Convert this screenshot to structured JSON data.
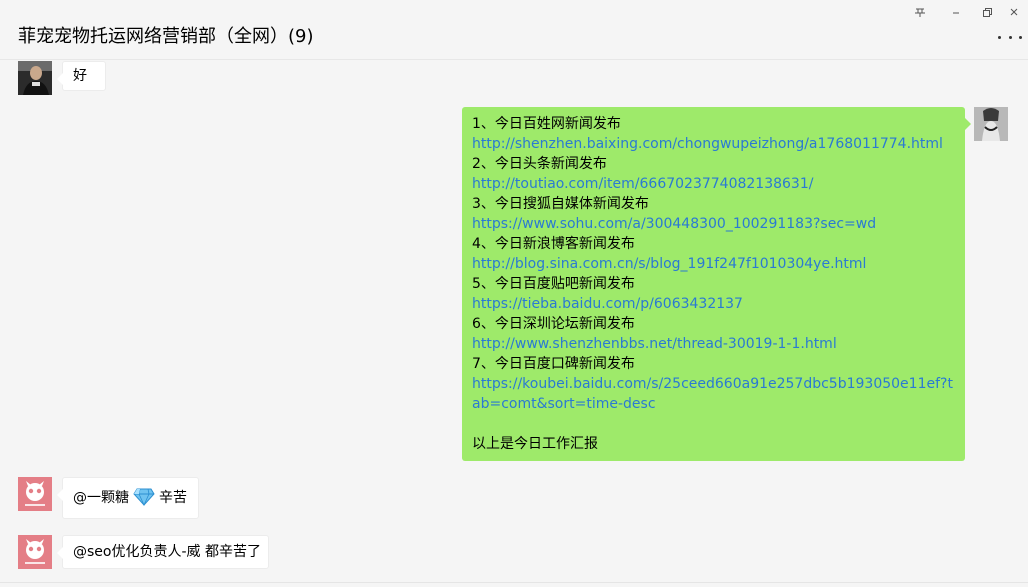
{
  "window": {
    "title": "菲宠宠物托运网络营销部（全网）(9)",
    "pin_icon": "pin-icon",
    "minimize_icon": "minimize-icon",
    "restore_icon": "restore-icon",
    "more_icon": "more-dots-icon"
  },
  "messages": [
    {
      "sender": "other",
      "avatar": "man-photo-avatar",
      "text": "好"
    },
    {
      "sender": "me",
      "avatar": "woman-photo-avatar",
      "lines": [
        {
          "kind": "text",
          "value": "1、今日百姓网新闻发布"
        },
        {
          "kind": "link",
          "value": "http://shenzhen.baixing.com/chongwupeizhong/a1768011774.html"
        },
        {
          "kind": "text",
          "value": "2、今日头条新闻发布"
        },
        {
          "kind": "link",
          "value": "http://toutiao.com/item/6667023774082138631/"
        },
        {
          "kind": "text",
          "value": "3、今日搜狐自媒体新闻发布"
        },
        {
          "kind": "link",
          "value": "https://www.sohu.com/a/300448300_100291183?sec=wd"
        },
        {
          "kind": "text",
          "value": "4、今日新浪博客新闻发布"
        },
        {
          "kind": "link",
          "value": "http://blog.sina.com.cn/s/blog_191f247f1010304ye.html"
        },
        {
          "kind": "text",
          "value": "5、今日百度贴吧新闻发布"
        },
        {
          "kind": "link",
          "value": "https://tieba.baidu.com/p/6063432137"
        },
        {
          "kind": "text",
          "value": "6、今日深圳论坛新闻发布"
        },
        {
          "kind": "link",
          "value": "http://www.shenzhenbbs.net/thread-30019-1-1.html"
        },
        {
          "kind": "text",
          "value": "7、今日百度口碑新闻发布"
        },
        {
          "kind": "link",
          "value": "https://koubei.baidu.com/s/25ceed660a91e257dbc5b193050e11ef?tab=comt&sort=time-desc"
        },
        {
          "kind": "text",
          "value": "以上是今日工作汇报"
        }
      ]
    },
    {
      "sender": "other",
      "avatar": "feichong-logo-avatar",
      "text_before": "@一颗糖",
      "emoji": "diamond-icon",
      "text_after": "辛苦"
    },
    {
      "sender": "other",
      "avatar": "feichong-logo-avatar",
      "text": "@seo优化负责人-威 都辛苦了"
    }
  ],
  "colors": {
    "my_bubble": "#9eea6a",
    "link": "#2a7ad3",
    "logo_pink": "#e47e86"
  }
}
